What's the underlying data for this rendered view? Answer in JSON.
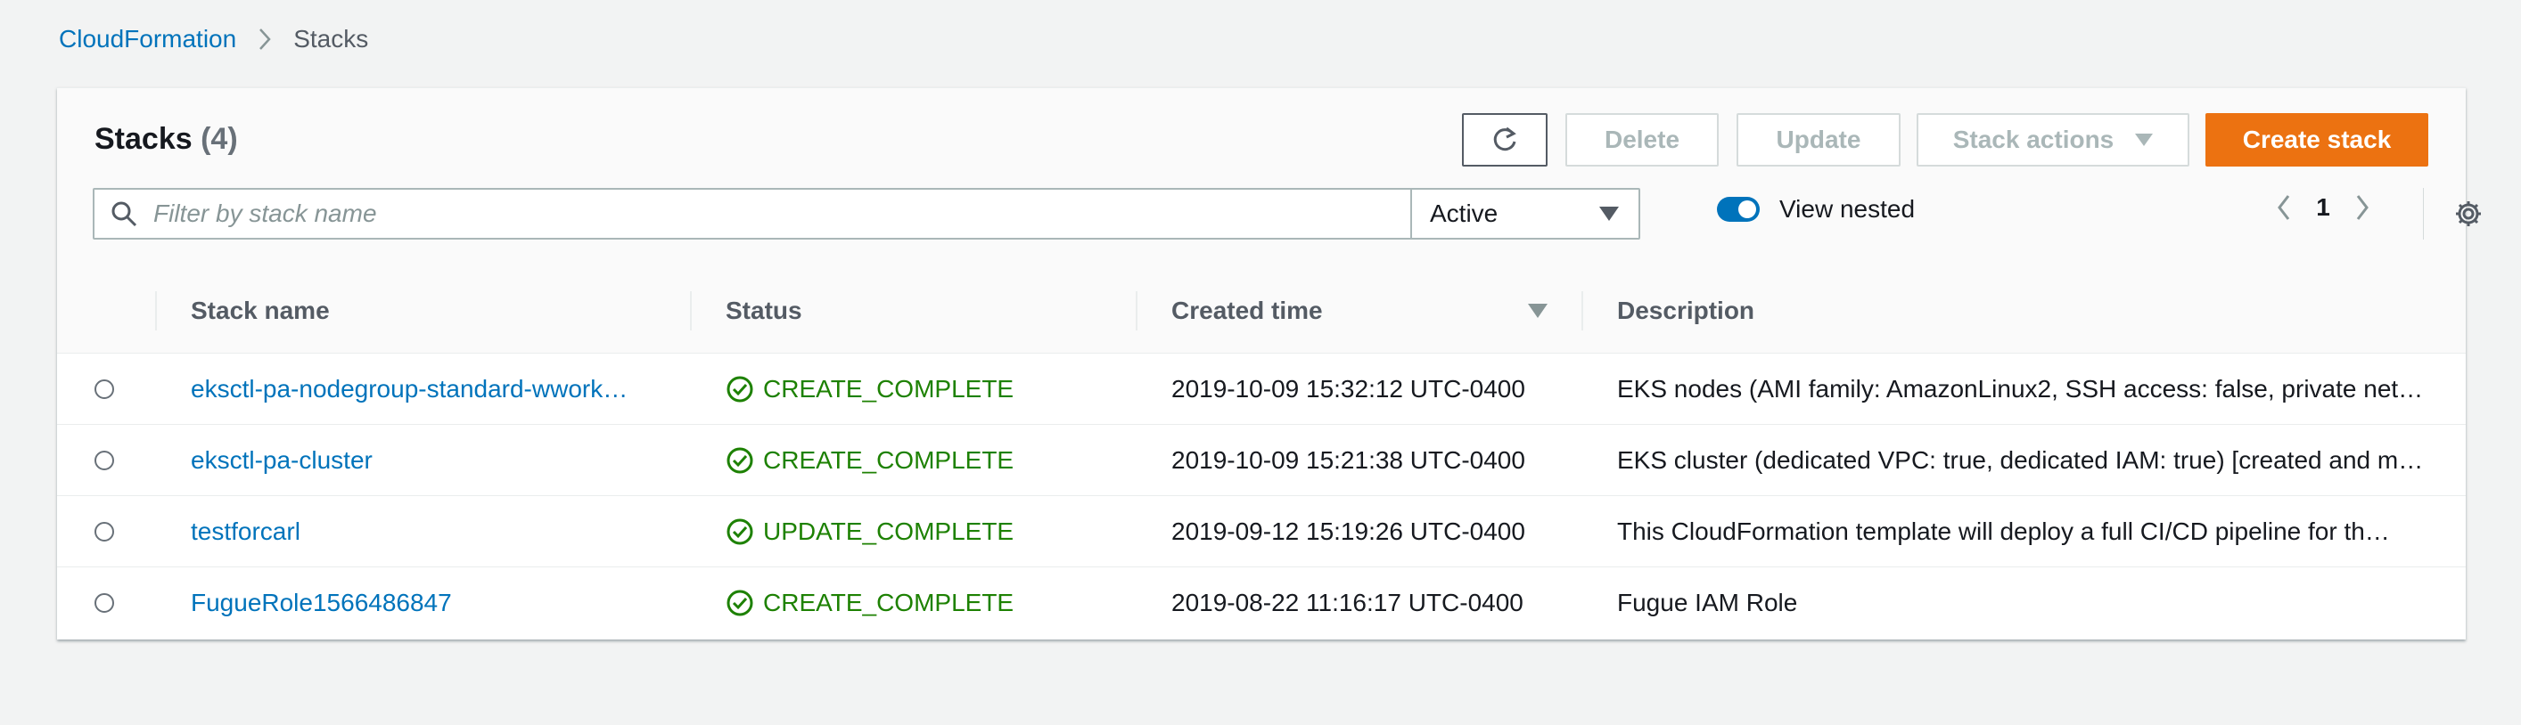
{
  "breadcrumb": {
    "root": "CloudFormation",
    "current": "Stacks"
  },
  "header": {
    "title": "Stacks",
    "count": "(4)"
  },
  "toolbar": {
    "refresh_icon": "refresh-icon",
    "delete_label": "Delete",
    "update_label": "Update",
    "stack_actions_label": "Stack actions",
    "create_label": "Create stack"
  },
  "filter": {
    "placeholder": "Filter by stack name",
    "status_selected": "Active",
    "view_nested_label": "View nested",
    "view_nested_on": true
  },
  "pagination": {
    "current_page": "1"
  },
  "table": {
    "columns": [
      "Stack name",
      "Status",
      "Created time",
      "Description"
    ],
    "sorted_column": "Created time",
    "rows": [
      {
        "name": "eksctl-pa-nodegroup-standard-wwork…",
        "status": "CREATE_COMPLETE",
        "created": "2019-10-09 15:32:12 UTC-0400",
        "description": "EKS nodes (AMI family: AmazonLinux2, SSH access: false, private net…"
      },
      {
        "name": "eksctl-pa-cluster",
        "status": "CREATE_COMPLETE",
        "created": "2019-10-09 15:21:38 UTC-0400",
        "description": "EKS cluster (dedicated VPC: true, dedicated IAM: true) [created and m…"
      },
      {
        "name": "testforcarl",
        "status": "UPDATE_COMPLETE",
        "created": "2019-09-12 15:19:26 UTC-0400",
        "description": "This CloudFormation template will deploy a full CI/CD pipeline for th…"
      },
      {
        "name": "FugueRole1566486847",
        "status": "CREATE_COMPLETE",
        "created": "2019-08-22 11:16:17 UTC-0400",
        "description": "Fugue IAM Role"
      }
    ]
  },
  "colors": {
    "link": "#0073bb",
    "success": "#1d8102",
    "primary_button": "#ec7211",
    "toggle_on": "#0073bb"
  }
}
